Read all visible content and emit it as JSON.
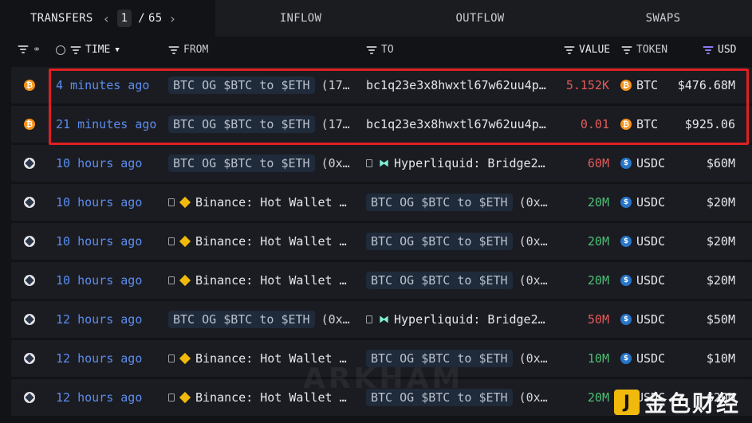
{
  "tabs": {
    "transfers": "TRANSFERS",
    "page_current": "1",
    "page_sep": "/",
    "page_total": "65",
    "inflow": "INFLOW",
    "outflow": "OUTFLOW",
    "swaps": "SWAPS"
  },
  "columns": {
    "time": "TIME",
    "from": "FROM",
    "to": "TO",
    "value": "VALUE",
    "token": "TOKEN",
    "usd": "USD"
  },
  "rows": [
    {
      "chain": "btc",
      "time": "4 minutes ago",
      "from_entity": "BTC OG $BTC to $ETH",
      "from_tail": "(17…",
      "to_addr": "bc1q23e3x8hwxtl67w62uu4p…",
      "value": "5.152K",
      "value_color": "red",
      "token": "BTC",
      "usd": "$476.68M"
    },
    {
      "chain": "btc",
      "time": "21 minutes ago",
      "from_entity": "BTC OG $BTC to $ETH",
      "from_tail": "(17…",
      "to_addr": "bc1q23e3x8hwxtl67w62uu4p…",
      "value": "0.01",
      "value_color": "red",
      "token": "BTC",
      "usd": "$925.06"
    },
    {
      "chain": "arb",
      "time": "10 hours ago",
      "from_entity": "BTC OG $BTC to $ETH",
      "from_tail": "(0x…",
      "to_name": "Hyperliquid: Bridge2…",
      "value": "60M",
      "value_color": "red",
      "token": "USDC",
      "usd": "$60M"
    },
    {
      "chain": "arb",
      "time": "10 hours ago",
      "from_name": "Binance: Hot Wallet …",
      "to_entity": "BTC OG $BTC to $ETH",
      "to_tail": "(0x…",
      "value": "20M",
      "value_color": "green",
      "token": "USDC",
      "usd": "$20M"
    },
    {
      "chain": "arb",
      "time": "10 hours ago",
      "from_name": "Binance: Hot Wallet …",
      "to_entity": "BTC OG $BTC to $ETH",
      "to_tail": "(0x…",
      "value": "20M",
      "value_color": "green",
      "token": "USDC",
      "usd": "$20M"
    },
    {
      "chain": "arb",
      "time": "10 hours ago",
      "from_name": "Binance: Hot Wallet …",
      "to_entity": "BTC OG $BTC to $ETH",
      "to_tail": "(0x…",
      "value": "20M",
      "value_color": "green",
      "token": "USDC",
      "usd": "$20M"
    },
    {
      "chain": "arb",
      "time": "12 hours ago",
      "from_entity": "BTC OG $BTC to $ETH",
      "from_tail": "(0x…",
      "to_name": "Hyperliquid: Bridge2…",
      "value": "50M",
      "value_color": "red",
      "token": "USDC",
      "usd": "$50M"
    },
    {
      "chain": "arb",
      "time": "12 hours ago",
      "from_name": "Binance: Hot Wallet …",
      "to_entity": "BTC OG $BTC to $ETH",
      "to_tail": "(0x…",
      "value": "10M",
      "value_color": "green",
      "token": "USDC",
      "usd": "$10M"
    },
    {
      "chain": "arb",
      "time": "12 hours ago",
      "from_name": "Binance: Hot Wallet …",
      "to_entity": "BTC OG $BTC to $ETH",
      "to_tail": "(0x…",
      "value": "20M",
      "value_color": "green",
      "token": "USDC",
      "usd": "$20M"
    }
  ],
  "watermark": "ARKHAM",
  "brand_text": "金色财经",
  "colors": {
    "link": "#5b8def",
    "red": "#e45b5b",
    "green": "#4fbf77",
    "btc": "#f7931a",
    "usdc": "#2775ca",
    "highlight": "#e02020"
  }
}
